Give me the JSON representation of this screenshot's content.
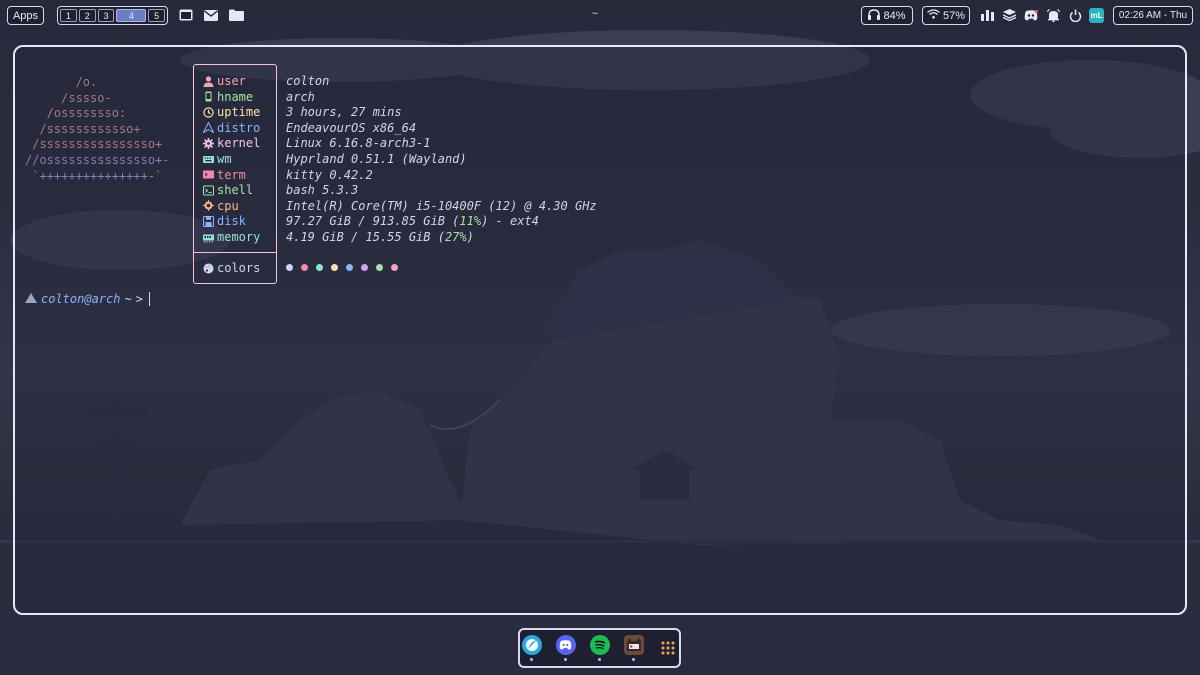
{
  "topbar": {
    "apps_label": "Apps",
    "workspaces": [
      {
        "label": "1",
        "active": false
      },
      {
        "label": "2",
        "active": false
      },
      {
        "label": "3",
        "active": false
      },
      {
        "label": "4",
        "active": true
      },
      {
        "label": "5",
        "active": false
      }
    ],
    "window_title": "~",
    "headset_battery": "84%",
    "wifi_strength": "57%",
    "clock": "02:26 AM - Thu",
    "badge_label": "mL"
  },
  "fetch": {
    "logo_lines": [
      "       /o.",
      "     /sssso-",
      "   /ossssssso:",
      "  /ssssssssssso+",
      " /ssssssssssssssso+",
      "//osssssssssssssso+-",
      " `+++++++++++++++-`"
    ],
    "rows": [
      {
        "label": "user",
        "icon": "user-icon",
        "color": "#f5a3b8",
        "value": "colton"
      },
      {
        "label": "hname",
        "icon": "phone-icon",
        "color": "#a6e3a1",
        "value": "arch"
      },
      {
        "label": "uptime",
        "icon": "clock-icon",
        "color": "#f9e2af",
        "value": "3 hours, 27 mins"
      },
      {
        "label": "distro",
        "icon": "arch-icon",
        "color": "#89b4fa",
        "value": "EndeavourOS x86_64"
      },
      {
        "label": "kernel",
        "icon": "gear-icon",
        "color": "#f5c2e7",
        "value": "Linux 6.16.8-arch3-1"
      },
      {
        "label": "wm",
        "icon": "keyboard-icon",
        "color": "#94e2d5",
        "value": "Hyprland 0.51.1 (Wayland)"
      },
      {
        "label": "term",
        "icon": "terminal-icon",
        "color": "#f38ba8",
        "value": "kitty 0.42.2"
      },
      {
        "label": "shell",
        "icon": "shell-icon",
        "color": "#a6e3a1",
        "value": "bash 5.3.3"
      },
      {
        "label": "cpu",
        "icon": "chip-icon",
        "color": "#fab387",
        "value": "Intel(R) Core(TM) i5-10400F (12) @ 4.30 GHz"
      },
      {
        "label": "disk",
        "icon": "disk-icon",
        "color": "#89b4fa",
        "value_parts": [
          "97.27 GiB / 913.85 GiB (",
          "11%",
          ") - ext4"
        ]
      },
      {
        "label": "memory",
        "icon": "memory-icon",
        "color": "#94e2d5",
        "value_parts": [
          "4.19 GiB / 15.55 GiB (",
          "27%",
          ")"
        ]
      }
    ],
    "colors_label": "colors",
    "palette": [
      "#cdd6f4",
      "#f38ba8",
      "#94e2d5",
      "#f9e2af",
      "#89b4fa",
      "#cba6f7",
      "#a6e3a1",
      "#f5a3b8"
    ],
    "percent_color": "#a6e3a1"
  },
  "prompt": {
    "user_host": "colton@arch",
    "path": "~",
    "symbol": ">"
  },
  "dock": {
    "apps": [
      {
        "name": "browser",
        "color": "#2aa8e0"
      },
      {
        "name": "discord",
        "color": "#5865f2"
      },
      {
        "name": "spotify",
        "color": "#1db954"
      },
      {
        "name": "terminal",
        "color": "#6b4a3a"
      },
      {
        "name": "app-grid",
        "color": "#1e2030"
      }
    ]
  }
}
